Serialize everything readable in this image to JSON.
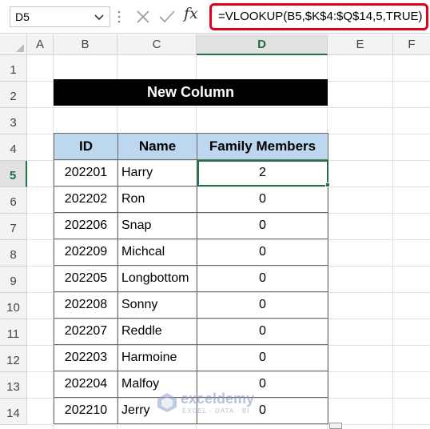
{
  "formula_bar": {
    "name_box": "D5",
    "fx": "fx",
    "formula": "=VLOOKUP(B5,$K$4:$Q$14,5,TRUE)"
  },
  "columns": [
    "A",
    "B",
    "C",
    "D",
    "E",
    "F"
  ],
  "rows": [
    "1",
    "2",
    "3",
    "4",
    "5",
    "6",
    "7",
    "8",
    "9",
    "10",
    "11",
    "12",
    "13",
    "14"
  ],
  "active_cell": {
    "column": "D",
    "row": "5"
  },
  "title": "New Column",
  "table": {
    "headers": [
      "ID",
      "Name",
      "Family Members"
    ],
    "rows": [
      [
        "202201",
        "Harry",
        "2"
      ],
      [
        "202202",
        "Ron",
        "0"
      ],
      [
        "202206",
        "Snap",
        "0"
      ],
      [
        "202209",
        "Michcal",
        "0"
      ],
      [
        "202205",
        "Longbottom",
        "0"
      ],
      [
        "202208",
        "Sonny",
        "0"
      ],
      [
        "202207",
        "Reddle",
        "0"
      ],
      [
        "202203",
        "Harmoine",
        "0"
      ],
      [
        "202204",
        "Malfoy",
        "0"
      ],
      [
        "202210",
        "Jerry",
        "0"
      ]
    ]
  },
  "watermark": {
    "brand": "exceldemy",
    "tagline": "EXCEL · DATA · BI"
  },
  "colors": {
    "accent": "#217346",
    "header_fill": "#bdd7ee",
    "formula_border": "#e0001b"
  }
}
